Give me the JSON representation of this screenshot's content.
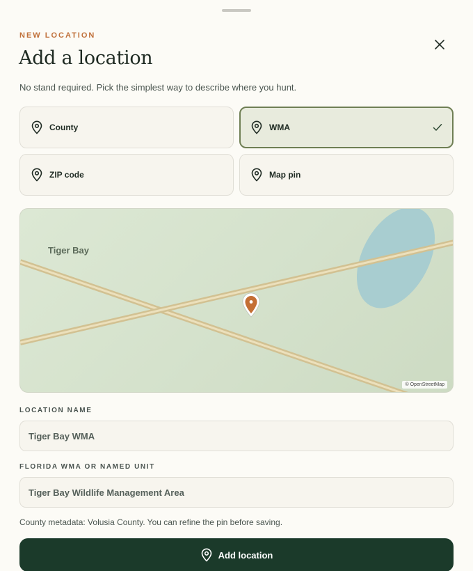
{
  "header": {
    "eyebrow": "NEW LOCATION",
    "title": "Add a location",
    "subtitle": "No stand required. Pick the simplest way to describe where you hunt."
  },
  "options": [
    {
      "label": "County",
      "selected": false
    },
    {
      "label": "WMA",
      "selected": true
    },
    {
      "label": "ZIP code",
      "selected": false
    },
    {
      "label": "Map pin",
      "selected": false
    }
  ],
  "map": {
    "place_label": "Tiger Bay",
    "attribution": "© OpenStreetMap"
  },
  "form": {
    "location_name_label": "LOCATION NAME",
    "location_name_value": "Tiger Bay WMA",
    "unit_label": "FLORIDA WMA OR NAMED UNIT",
    "unit_value": "Tiger Bay Wildlife Management Area"
  },
  "meta_text": "County metadata: Volusia County. You can refine the pin before saving.",
  "submit_label": "Add location",
  "colors": {
    "accent": "#c0703a",
    "primary": "#1b3a2a",
    "selected_border": "#6f7f54",
    "water": "#a8cdd0",
    "road": "#d7c79c"
  }
}
